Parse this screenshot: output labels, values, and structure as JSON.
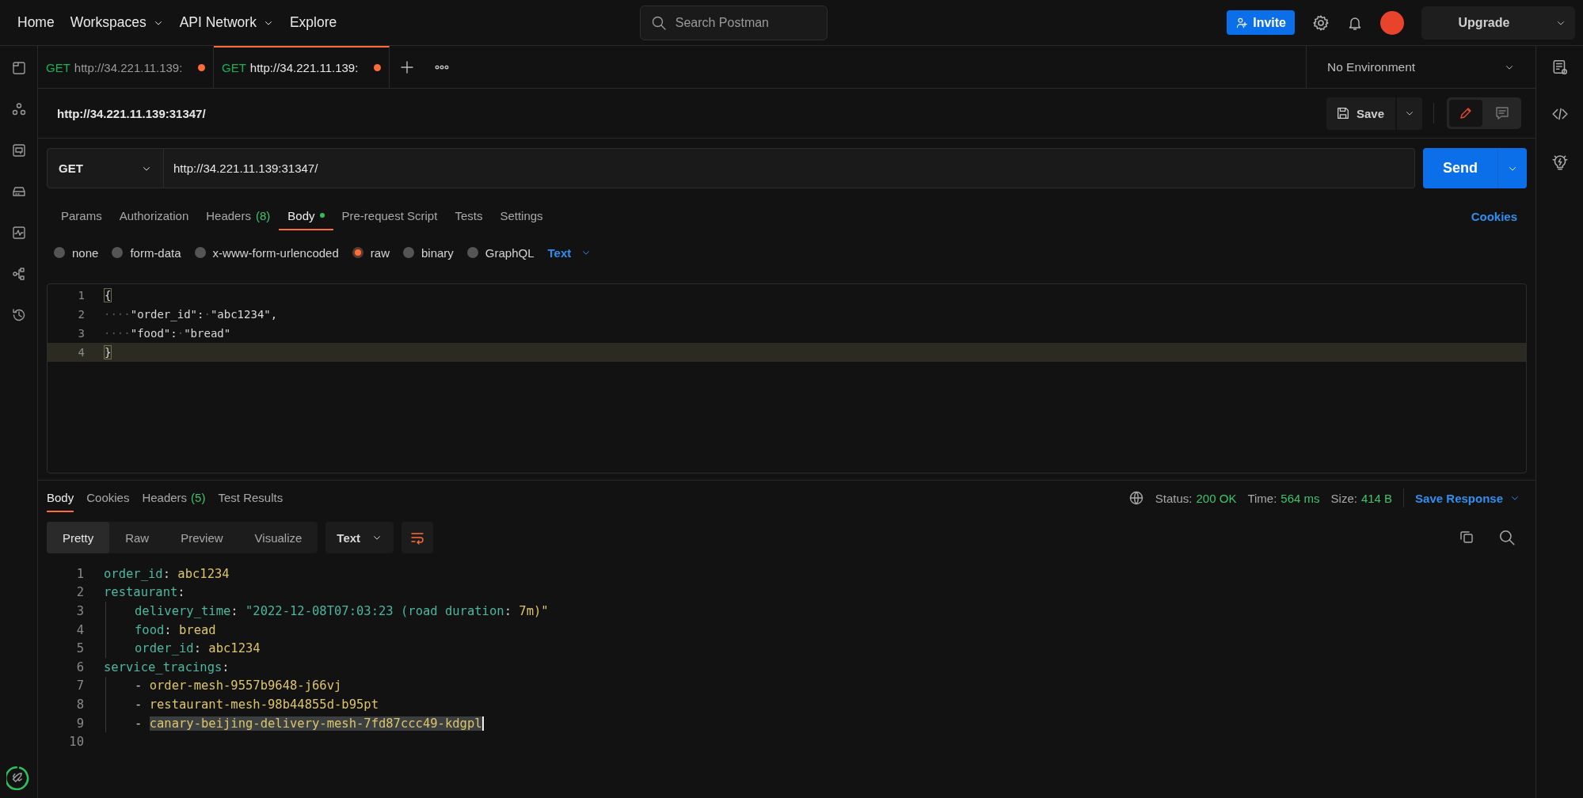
{
  "nav": {
    "items": [
      {
        "label": "Home",
        "dropdown": false
      },
      {
        "label": "Workspaces",
        "dropdown": true
      },
      {
        "label": "API Network",
        "dropdown": true
      },
      {
        "label": "Explore",
        "dropdown": false
      }
    ],
    "search": {
      "placeholder": "Search Postman"
    },
    "invite": "Invite",
    "upgrade": "Upgrade"
  },
  "tabs": [
    {
      "method": "GET",
      "url": "http://34.221.11.139:",
      "unsaved": true,
      "selected": false
    },
    {
      "method": "GET",
      "url": "http://34.221.11.139:",
      "unsaved": true,
      "selected": true
    }
  ],
  "environment": "No Environment",
  "request": {
    "title": "http://34.221.11.139:31347/",
    "save": "Save",
    "view_toggle": [
      {
        "kind": "edit",
        "selected": true
      },
      {
        "kind": "comments",
        "selected": false
      }
    ],
    "method": "GET",
    "url": "http://34.221.11.139:31347/",
    "send": "Send",
    "subtabs": [
      {
        "label": "Params",
        "selected": false
      },
      {
        "label": "Authorization",
        "selected": false
      },
      {
        "label": "Headers",
        "count": "(8)",
        "selected": false
      },
      {
        "label": "Body",
        "has_content": true,
        "selected": true
      },
      {
        "label": "Pre-request Script",
        "selected": false
      },
      {
        "label": "Tests",
        "selected": false
      },
      {
        "label": "Settings",
        "selected": false
      }
    ],
    "cookies": "Cookies",
    "body_types": [
      {
        "label": "none",
        "selected": false
      },
      {
        "label": "form-data",
        "selected": false
      },
      {
        "label": "x-www-form-urlencoded",
        "selected": false
      },
      {
        "label": "raw",
        "selected": true
      },
      {
        "label": "binary",
        "selected": false
      },
      {
        "label": "GraphQL",
        "selected": false
      }
    ],
    "body_format": "Text",
    "editor_lines": [
      {
        "number": "1",
        "current": false,
        "tokens": [
          {
            "kind": "bracket",
            "text": "{"
          }
        ]
      },
      {
        "number": "2",
        "current": false,
        "tokens": [
          {
            "kind": "ws",
            "text": "····"
          },
          {
            "kind": "text",
            "text": "\"order_id\":"
          },
          {
            "kind": "ws",
            "text": "·"
          },
          {
            "kind": "text",
            "text": "\"abc1234\","
          }
        ]
      },
      {
        "number": "3",
        "current": false,
        "tokens": [
          {
            "kind": "ws",
            "text": "····"
          },
          {
            "kind": "text",
            "text": "\"food\":"
          },
          {
            "kind": "ws",
            "text": "·"
          },
          {
            "kind": "text",
            "text": "\"bread\""
          }
        ]
      },
      {
        "number": "4",
        "current": true,
        "tokens": [
          {
            "kind": "bracket",
            "text": "}"
          }
        ]
      }
    ]
  },
  "response": {
    "tabs": [
      {
        "label": "Body",
        "selected": true
      },
      {
        "label": "Cookies",
        "selected": false
      },
      {
        "label": "Headers",
        "count": "(5)",
        "selected": false
      },
      {
        "label": "Test Results",
        "selected": false
      }
    ],
    "status_label": "Status:",
    "status": "200 OK",
    "time_label": "Time:",
    "time": "564 ms",
    "size_label": "Size:",
    "size": "414 B",
    "save": "Save Response",
    "views": [
      {
        "label": "Pretty",
        "selected": true
      },
      {
        "label": "Raw",
        "selected": false
      },
      {
        "label": "Preview",
        "selected": false
      },
      {
        "label": "Visualize",
        "selected": false
      }
    ],
    "format": "Text",
    "wrap": true,
    "lines": [
      {
        "number": "1",
        "tokens": [
          {
            "kind": "key",
            "text": "order_id"
          },
          {
            "kind": "punct",
            "text": ": "
          },
          {
            "kind": "value",
            "text": "abc1234"
          }
        ]
      },
      {
        "number": "2",
        "tokens": [
          {
            "kind": "key",
            "text": "restaurant"
          },
          {
            "kind": "punct",
            "text": ":"
          }
        ],
        "children": [
          {
            "number": "3",
            "tokens": [
              {
                "kind": "key",
                "text": "delivery_time"
              },
              {
                "kind": "punct",
                "text": ": "
              },
              {
                "kind": "string",
                "text": "\"2022-12-08T07:03:23 (road duration"
              },
              {
                "kind": "punct",
                "text": ": "
              },
              {
                "kind": "value",
                "text": "7m)\""
              }
            ]
          },
          {
            "number": "4",
            "tokens": [
              {
                "kind": "key",
                "text": "food"
              },
              {
                "kind": "punct",
                "text": ": "
              },
              {
                "kind": "value",
                "text": "bread"
              }
            ]
          },
          {
            "number": "5",
            "tokens": [
              {
                "kind": "key",
                "text": "order_id"
              },
              {
                "kind": "punct",
                "text": ": "
              },
              {
                "kind": "value",
                "text": "abc1234"
              }
            ]
          }
        ]
      },
      {
        "number": "6",
        "tokens": [
          {
            "kind": "key",
            "text": "service_tracings"
          },
          {
            "kind": "punct",
            "text": ":"
          }
        ],
        "children": [
          {
            "number": "7",
            "tokens": [
              {
                "kind": "punct",
                "text": "- "
              },
              {
                "kind": "value",
                "text": "order-mesh-9557b9648-j66vj"
              }
            ]
          },
          {
            "number": "8",
            "tokens": [
              {
                "kind": "punct",
                "text": "- "
              },
              {
                "kind": "value",
                "text": "restaurant-mesh-98b44855d-b95pt"
              }
            ]
          },
          {
            "number": "9",
            "tokens": [
              {
                "kind": "punct",
                "text": "- "
              },
              {
                "kind": "selected-value",
                "text": "canary-beijing-delivery-mesh-7fd87ccc49-kdgpl"
              }
            ]
          }
        ]
      },
      {
        "number": "10"
      }
    ]
  }
}
